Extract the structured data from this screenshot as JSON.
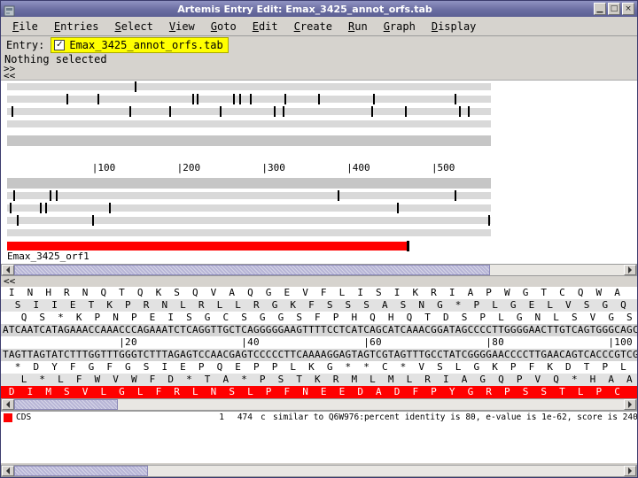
{
  "window": {
    "title": "Artemis Entry Edit: Emax_3425_annot_orfs.tab",
    "minimize_glyph": "▁",
    "maximize_glyph": "□",
    "close_glyph": "×"
  },
  "menubar": {
    "items": [
      "File",
      "Entries",
      "Select",
      "View",
      "Goto",
      "Edit",
      "Create",
      "Run",
      "Graph",
      "Display"
    ]
  },
  "entry_bar": {
    "label": "Entry:",
    "checkbox_glyph": "✓",
    "file_name": "Emax_3425_annot_orfs.tab",
    "highlight_color": "#ffff00"
  },
  "status": {
    "text": "Nothing selected"
  },
  "overview": {
    "nav_forward": ">>",
    "nav_back": "<<",
    "sequence_length": 570,
    "ruler_ticks": [
      100,
      200,
      300,
      400,
      500
    ],
    "forward_frame_stops": [
      [
        150
      ],
      [
        70,
        107,
        218,
        223,
        266,
        274,
        286,
        327,
        366,
        431,
        527
      ],
      [
        5,
        144,
        191,
        251,
        314,
        325,
        429,
        469,
        532,
        543
      ]
    ],
    "reverse_frame_stops": [
      [
        7,
        50,
        57,
        389,
        527
      ],
      [
        3,
        39,
        45,
        120,
        459
      ],
      [
        12,
        100,
        567
      ]
    ],
    "feature": {
      "name": "Emax_3425_orf1",
      "start": 1,
      "end": 474,
      "strand": "reverse",
      "color": "#ff0000"
    }
  },
  "detail": {
    "nav_back": "<<",
    "ruler_ticks": [
      20,
      40,
      60,
      80,
      100
    ],
    "sequence": "ATCAATCATAGAAACCAAACCCAGAAATCTCAGGTTGCTCAGGGGGAAGTTTTCCTCATCAGCATCAAACGGATAGCCCCTTGGGGAACTTGTCAGTGGGCAGC",
    "complement": "TAGTTAGTATCTTTGGTTTGGGTCTTTAGAGTCCAACGAGTCCCCCTTCAAAAGGAGTAGTCGTAGTTTGCCTATCGGGGAACCCCTTGAACAGTCACCCGTCG",
    "forward_frames": [
      "INHRNQTQKSQVAQGEVFLISIKRIAPWGTCQWA",
      "SIIETKPRNLRLLRGKFSSSASNG*PLGELVSGQ",
      "QS*KPNPEISGCSGGSFPHQHQTDSPLGNLSVGS"
    ],
    "reverse_frames": [
      "*DYFGFGSIEPQEPPLKG**C*VSLGKPFKDTPL",
      "L*LFWVWFD*TA*PSTKRMLMLRIAGQPVQ*HAA"
    ],
    "cds_translation": "DIMSVLGLFRLNSLPFNEEDADFPYGRPSSTLPC",
    "cds_color": "#ff0000"
  },
  "scrollbars": {
    "overview": {
      "thumb_left_pct": 0,
      "thumb_width_pct": 78
    },
    "detail": {
      "thumb_left_pct": 0,
      "thumb_width_pct": 17
    },
    "bottom": {
      "thumb_left_pct": 0,
      "thumb_width_pct": 22
    }
  },
  "feature_list": {
    "rows": [
      {
        "color": "#ff0000",
        "type": "CDS",
        "start": "1",
        "end": "474",
        "strand": "c",
        "note": "similar to Q6W976:percent identity is 80, e-value is 1e-62, score is 240"
      }
    ]
  }
}
